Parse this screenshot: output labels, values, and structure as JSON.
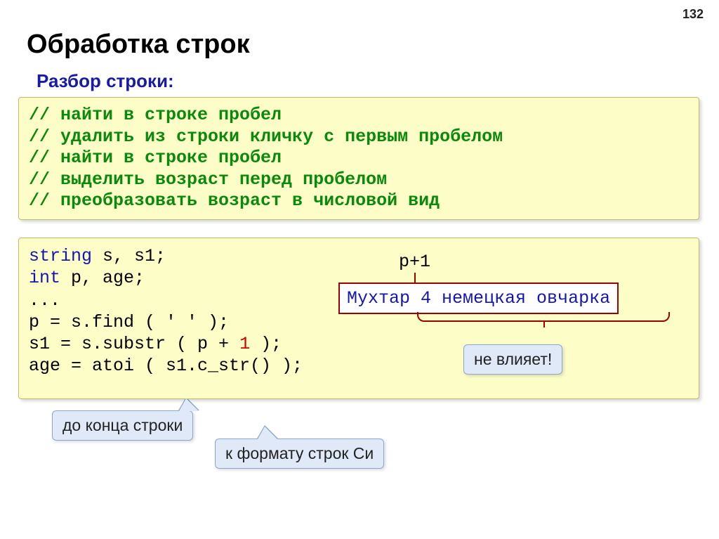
{
  "page_number": "132",
  "title": "Обработка строк",
  "subtitle": "Разбор строки:",
  "comments": [
    "// найти в строке пробел",
    "// удалить из строки кличку с первым пробелом",
    "// найти в строке пробел",
    "// выделить возраст перед пробелом",
    "// преобразовать возраст в числовой вид"
  ],
  "code": {
    "l1_kw": "string",
    "l1_rest": " s, s1;",
    "l2_kw": "int",
    "l2_rest": " p, age;",
    "l3": "...",
    "l4": "p = s.find ( ' ' );",
    "l5a": "s1 = s.substr ( p + ",
    "l5num": "1",
    "l5b": " );",
    "l6": "age = atoi ( s1.c_str() );"
  },
  "example": {
    "p1_label": "p+1",
    "part1": "Мухтар",
    "part2": "4 немецкая овчарка"
  },
  "notes": {
    "no_effect": "не влияет!",
    "to_end": "до конца строки",
    "c_format": "к формату строк Си"
  }
}
